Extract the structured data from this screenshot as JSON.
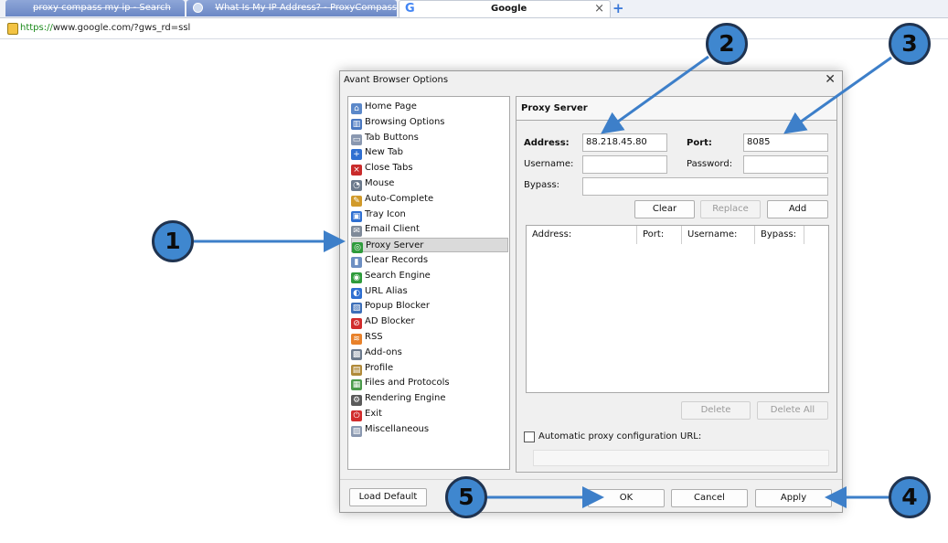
{
  "browser": {
    "tabs": [
      {
        "label": "proxy compass my ip - Search"
      },
      {
        "label": "What Is My IP Address? - ProxyCompass"
      },
      {
        "label": "Google"
      }
    ],
    "new_tab_label": "+",
    "close_glyph": "×",
    "url_scheme": "https://",
    "url_rest": "www.google.com/?gws_rd=ssl"
  },
  "dialog": {
    "title": "Avant Browser Options",
    "close_glyph": "✕",
    "nav": [
      {
        "label": "Home Page",
        "icon": "home-icon",
        "color": "#5b88c9"
      },
      {
        "label": "Browsing Options",
        "icon": "browsing-options-icon",
        "color": "#4a78c0"
      },
      {
        "label": "Tab Buttons",
        "icon": "tab-buttons-icon",
        "color": "#8a98b0"
      },
      {
        "label": "New Tab",
        "icon": "plus-icon",
        "color": "#2f6fd1"
      },
      {
        "label": "Close Tabs",
        "icon": "close-tab-icon",
        "color": "#c92b2b"
      },
      {
        "label": "Mouse",
        "icon": "mouse-icon",
        "color": "#6c7a8c"
      },
      {
        "label": "Auto-Complete",
        "icon": "auto-complete-icon",
        "color": "#d19a2a"
      },
      {
        "label": "Tray Icon",
        "icon": "tray-icon",
        "color": "#2f6fd1"
      },
      {
        "label": "Email Client",
        "icon": "email-icon",
        "color": "#7f8a99"
      },
      {
        "label": "Proxy Server",
        "icon": "globe-icon",
        "color": "#2e9b3b"
      },
      {
        "label": "Clear Records",
        "icon": "trash-icon",
        "color": "#6d8fc2"
      },
      {
        "label": "Search Engine",
        "icon": "search-engine-icon",
        "color": "#2e9b3b"
      },
      {
        "label": "URL Alias",
        "icon": "url-alias-icon",
        "color": "#2f6fd1"
      },
      {
        "label": "Popup Blocker",
        "icon": "popup-blocker-icon",
        "color": "#3d6fb8"
      },
      {
        "label": "AD Blocker",
        "icon": "ad-blocker-icon",
        "color": "#d12c2c"
      },
      {
        "label": "RSS",
        "icon": "rss-icon",
        "color": "#e8812a"
      },
      {
        "label": "Add-ons",
        "icon": "add-ons-icon",
        "color": "#6c7a8c"
      },
      {
        "label": "Profile",
        "icon": "profile-icon",
        "color": "#b08a3a"
      },
      {
        "label": "Files and Protocols",
        "icon": "files-protocols-icon",
        "color": "#4a9a4a"
      },
      {
        "label": "Rendering Engine",
        "icon": "rendering-engine-icon",
        "color": "#5a5a5a"
      },
      {
        "label": "Exit",
        "icon": "power-icon",
        "color": "#d12c2c"
      },
      {
        "label": "Miscellaneous",
        "icon": "miscellaneous-icon",
        "color": "#8a98b0"
      }
    ],
    "selected_nav": "Proxy Server",
    "panel_title": "Proxy Server",
    "address_label": "Address:",
    "address_value": "88.218.45.80",
    "port_label": "Port:",
    "port_value": "8085",
    "username_label": "Username:",
    "username_value": "",
    "password_label": "Password:",
    "password_value": "",
    "bypass_label": "Bypass:",
    "bypass_value": "",
    "clear_label": "Clear",
    "replace_label": "Replace",
    "add_label": "Add",
    "grid_columns": [
      "Address:",
      "Port:",
      "Username:",
      "Bypass:"
    ],
    "delete_label": "Delete",
    "delete_all_label": "Delete All",
    "auto_proxy_label": "Automatic proxy configuration URL:",
    "auto_proxy_checked": false,
    "auto_proxy_value": "",
    "load_default_label": "Load Default",
    "ok_label": "OK",
    "cancel_label": "Cancel",
    "apply_label": "Apply"
  },
  "callouts": [
    {
      "number": "1",
      "target": "Proxy Server"
    },
    {
      "number": "2",
      "target": "Address"
    },
    {
      "number": "3",
      "target": "Port"
    },
    {
      "number": "4",
      "target": "Apply"
    },
    {
      "number": "5",
      "target": "OK"
    }
  ],
  "colors": {
    "callout_fill": "#3f87cf",
    "callout_border": "#1f3350",
    "arrow": "#3d7fc9",
    "tab_background": "#7a95cf"
  }
}
